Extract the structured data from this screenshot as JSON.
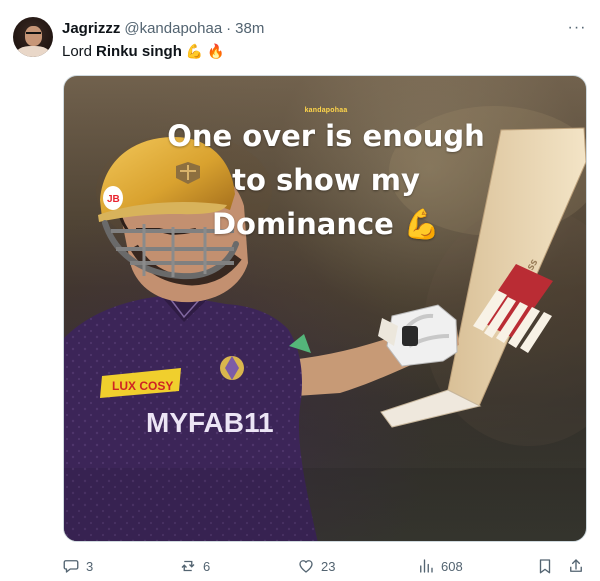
{
  "tweet": {
    "display_name": "Jagrizzz",
    "handle": "@kandapohaa",
    "separator": "·",
    "time": "38m",
    "text_plain": "Lord",
    "text_bold": "Rinku singh",
    "emojis": [
      "💪",
      "🔥"
    ],
    "more_label": "···"
  },
  "media": {
    "watermark": "kandapohaa",
    "caption_lines": [
      "One over is enough",
      "to show my",
      "Dominance 💪"
    ],
    "jersey_sponsor": "MYFAB11",
    "chest_sponsor": "LUX COSY",
    "bat_label": "SS"
  },
  "actions": {
    "replies": "3",
    "retweets": "6",
    "likes": "23",
    "views": "608"
  },
  "icons": {
    "reply": "reply-icon",
    "retweet": "retweet-icon",
    "like": "heart-icon",
    "views": "bar-chart-icon",
    "bookmark": "bookmark-icon",
    "share": "share-icon"
  },
  "colors": {
    "text": "#0f1419",
    "muted": "#536471",
    "jersey": "#3c2558",
    "helmet": "#d9a22f",
    "caption": "#ffffff",
    "watermark": "#ffd64a"
  }
}
